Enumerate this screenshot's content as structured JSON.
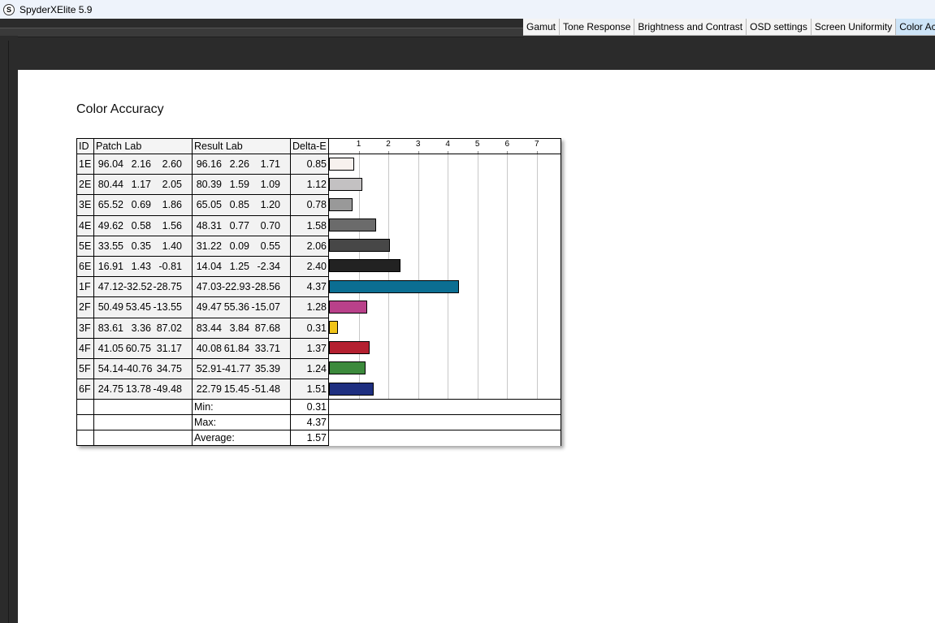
{
  "window": {
    "title": "SpyderXElite 5.9",
    "icon": "S"
  },
  "tabs": [
    {
      "label": "Gamut",
      "active": false
    },
    {
      "label": "Tone Response",
      "active": false
    },
    {
      "label": "Brightness and Contrast",
      "active": false
    },
    {
      "label": "OSD settings",
      "active": false
    },
    {
      "label": "Screen Uniformity",
      "active": false
    },
    {
      "label": "Color Acc",
      "active": true
    }
  ],
  "report": {
    "title": "Color Accuracy",
    "headers": {
      "id": "ID",
      "patch": "Patch Lab",
      "result": "Result Lab",
      "delta": "Delta-E"
    },
    "rows": [
      {
        "id": "1E",
        "patch": [
          "96.04",
          "2.16",
          "2.60"
        ],
        "result": [
          "96.16",
          "2.26",
          "1.71"
        ],
        "delta": "0.85"
      },
      {
        "id": "2E",
        "patch": [
          "80.44",
          "1.17",
          "2.05"
        ],
        "result": [
          "80.39",
          "1.59",
          "1.09"
        ],
        "delta": "1.12"
      },
      {
        "id": "3E",
        "patch": [
          "65.52",
          "0.69",
          "1.86"
        ],
        "result": [
          "65.05",
          "0.85",
          "1.20"
        ],
        "delta": "0.78"
      },
      {
        "id": "4E",
        "patch": [
          "49.62",
          "0.58",
          "1.56"
        ],
        "result": [
          "48.31",
          "0.77",
          "0.70"
        ],
        "delta": "1.58"
      },
      {
        "id": "5E",
        "patch": [
          "33.55",
          "0.35",
          "1.40"
        ],
        "result": [
          "31.22",
          "0.09",
          "0.55"
        ],
        "delta": "2.06"
      },
      {
        "id": "6E",
        "patch": [
          "16.91",
          "1.43",
          "-0.81"
        ],
        "result": [
          "14.04",
          "1.25",
          "-2.34"
        ],
        "delta": "2.40"
      },
      {
        "id": "1F",
        "patch": [
          "47.12",
          "-32.52",
          "-28.75"
        ],
        "result": [
          "47.03",
          "-22.93",
          "-28.56"
        ],
        "delta": "4.37"
      },
      {
        "id": "2F",
        "patch": [
          "50.49",
          "53.45",
          "-13.55"
        ],
        "result": [
          "49.47",
          "55.36",
          "-15.07"
        ],
        "delta": "1.28"
      },
      {
        "id": "3F",
        "patch": [
          "83.61",
          "3.36",
          "87.02"
        ],
        "result": [
          "83.44",
          "3.84",
          "87.68"
        ],
        "delta": "0.31"
      },
      {
        "id": "4F",
        "patch": [
          "41.05",
          "60.75",
          "31.17"
        ],
        "result": [
          "40.08",
          "61.84",
          "33.71"
        ],
        "delta": "1.37"
      },
      {
        "id": "5F",
        "patch": [
          "54.14",
          "-40.76",
          "34.75"
        ],
        "result": [
          "52.91",
          "-41.77",
          "35.39"
        ],
        "delta": "1.24"
      },
      {
        "id": "6F",
        "patch": [
          "24.75",
          "13.78",
          "-49.48"
        ],
        "result": [
          "22.79",
          "15.45",
          "-51.48"
        ],
        "delta": "1.51"
      }
    ],
    "summary": [
      {
        "label": "Min:",
        "value": "0.31"
      },
      {
        "label": "Max:",
        "value": "4.37"
      },
      {
        "label": "Average:",
        "value": "1.57"
      }
    ]
  },
  "chart_data": {
    "type": "bar",
    "orientation": "horizontal",
    "categories": [
      "1E",
      "2E",
      "3E",
      "4E",
      "5E",
      "6E",
      "1F",
      "2F",
      "3F",
      "4F",
      "5F",
      "6F"
    ],
    "values": [
      0.85,
      1.12,
      0.78,
      1.58,
      2.06,
      2.4,
      4.37,
      1.28,
      0.31,
      1.37,
      1.24,
      1.51
    ],
    "colors": [
      "#f7f1ee",
      "#c3c1c2",
      "#999999",
      "#6b6b6b",
      "#474747",
      "#222222",
      "#0b6e92",
      "#b9418a",
      "#f0c419",
      "#b42030",
      "#3c8a3c",
      "#1e2f80"
    ],
    "xticks": [
      "1",
      "2",
      "3",
      "4",
      "5",
      "6",
      "7"
    ],
    "xlim": [
      0,
      7.8
    ],
    "grid": true
  }
}
